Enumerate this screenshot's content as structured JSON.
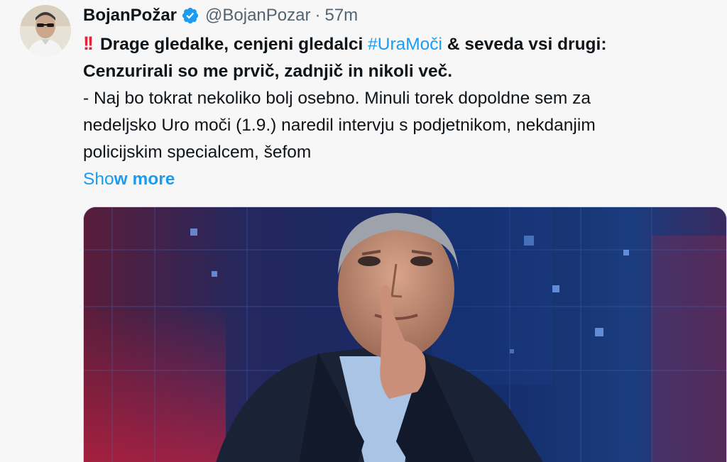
{
  "tweet": {
    "author": {
      "display_name": "BojanPožar",
      "handle": "@BojanPozar",
      "separator": "·",
      "time": "57m",
      "verified": true,
      "avatar": "avatar"
    },
    "text": {
      "emoji": "!!",
      "line1_pre": "Drage gledalke, cenjeni gledalci",
      "hashtag": "#UraMoči",
      "line1_post": "& seveda vsi drugi:",
      "line2": "Cenzurirali so me prvič, zadnjič in nikoli več.",
      "line3": "- Naj bo tokrat nekoliko bolj osebno. Minuli torek dopoldne sem za",
      "line4": "nedeljsko Uro moči (1.9.) naredil intervju s podjetnikom, nekdanjim",
      "line5": "policijskim specialcem, šefom"
    },
    "show_more": {
      "part1": "Sho",
      "part2": "w more"
    },
    "media": {
      "description_icon": "promo-image"
    },
    "colors": {
      "link": "#1d9bf0",
      "text": "#0f1419",
      "secondary": "#536471",
      "emoji_red": "#e0243a"
    }
  }
}
